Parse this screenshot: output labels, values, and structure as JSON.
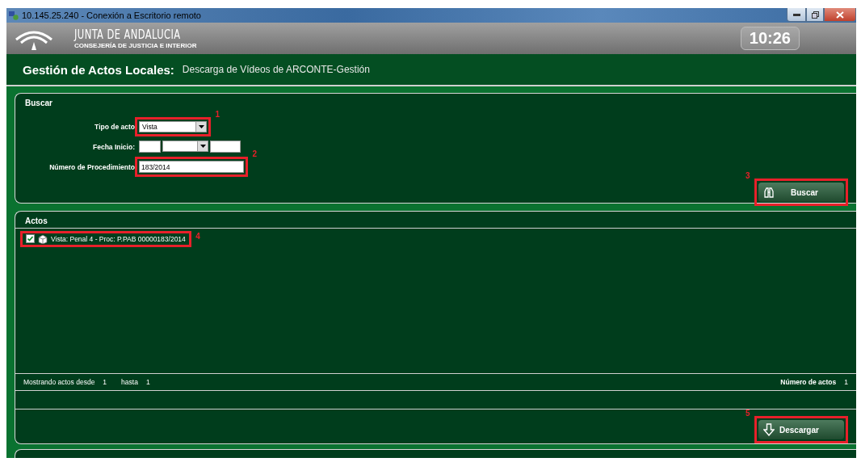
{
  "window": {
    "title": "10.145.25.240 - Conexión a Escritorio remoto"
  },
  "header": {
    "org": "JUNTA DE ANDALUCIA",
    "department": "CONSEJERÍA DE JUSTICIA E INTERIOR",
    "clock": "10:26"
  },
  "page": {
    "title": "Gestión de Actos Locales:",
    "subtitle": "Descarga de Vídeos de ARCONTE-Gestión"
  },
  "search_panel": {
    "title": "Buscar",
    "fields": [
      {
        "kind": "select",
        "label": "Tipo de acto",
        "value": "Vista",
        "callout": "1"
      },
      {
        "kind": "date",
        "label": "Fecha Inicio:"
      },
      {
        "kind": "text",
        "label": "Número de Procedimiento",
        "value": "183/2014",
        "callout": "2"
      }
    ],
    "button": {
      "label": "Buscar",
      "callout": "3"
    }
  },
  "acts_panel": {
    "title": "Actos",
    "items": [
      {
        "label": "Vista: Penal 4 - Proc: P.PAB 00000183/2014",
        "checked": true,
        "callout": "4"
      }
    ],
    "range_label": "Mostrando actos desde",
    "from": "1",
    "to_label": "hasta",
    "to": "1",
    "count_label": "Número de actos",
    "count": "1",
    "button": {
      "label": "Descargar",
      "callout": "5"
    }
  }
}
